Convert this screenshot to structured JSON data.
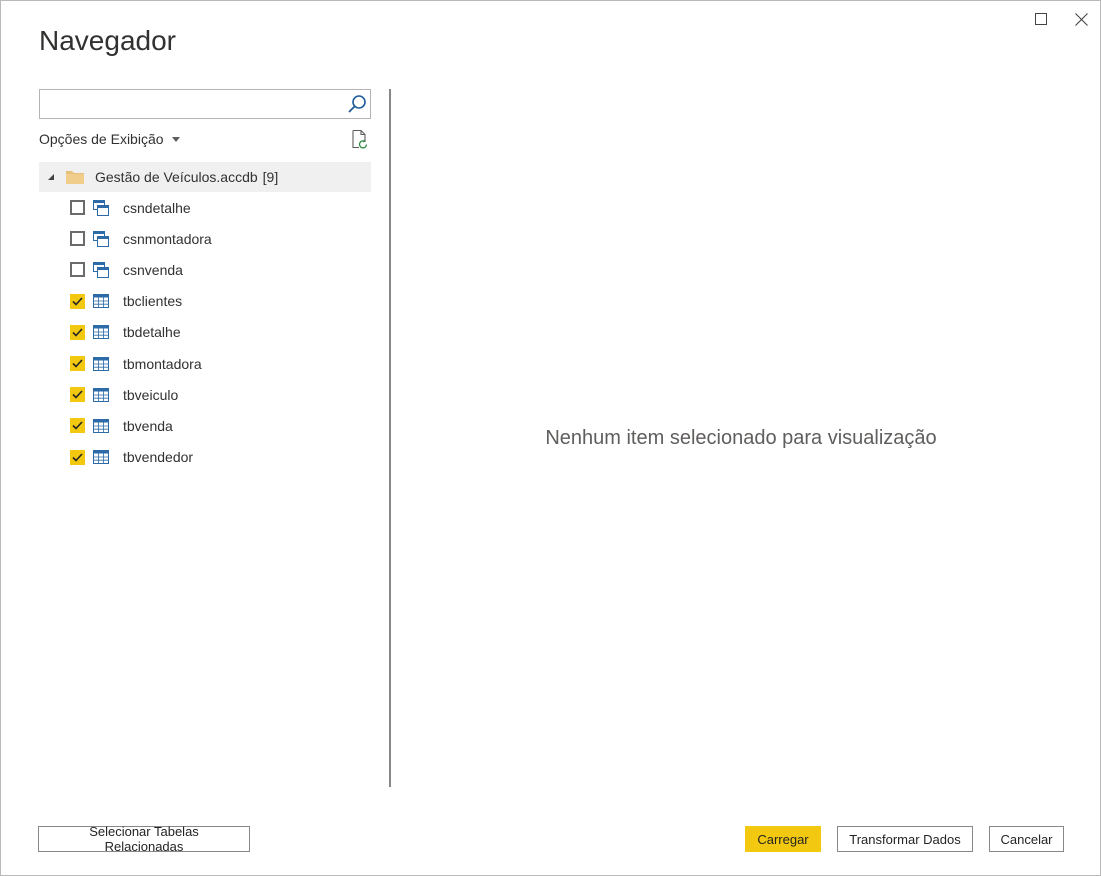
{
  "window": {
    "title": "Navegador",
    "maximize_icon": "maximize-icon",
    "close_icon": "close-icon"
  },
  "search": {
    "value": "",
    "placeholder": "",
    "icon": "search-icon"
  },
  "view_options": {
    "label": "Opções de Exibição",
    "icon": "caret-down-icon"
  },
  "refresh": {
    "icon": "refresh-document-icon"
  },
  "tree": {
    "root": {
      "label": "Gestão de Veículos.accdb",
      "count": "[9]",
      "icon": "folder-icon",
      "expanded": true
    },
    "items": [
      {
        "label": "csndetalhe",
        "type": "view",
        "checked": false
      },
      {
        "label": "csnmontadora",
        "type": "view",
        "checked": false
      },
      {
        "label": "csnvenda",
        "type": "view",
        "checked": false
      },
      {
        "label": "tbclientes",
        "type": "table",
        "checked": true
      },
      {
        "label": "tbdetalhe",
        "type": "table",
        "checked": true
      },
      {
        "label": "tbmontadora",
        "type": "table",
        "checked": true
      },
      {
        "label": "tbveiculo",
        "type": "table",
        "checked": true
      },
      {
        "label": "tbvenda",
        "type": "table",
        "checked": true
      },
      {
        "label": "tbvendedor",
        "type": "table",
        "checked": true
      }
    ]
  },
  "preview": {
    "message": "Nenhum item selecionado para visualização"
  },
  "footer": {
    "select_related": "Selecionar Tabelas Relacionadas",
    "load": "Carregar",
    "transform": "Transformar Dados",
    "cancel": "Cancelar"
  },
  "colors": {
    "accent": "#f2c811",
    "checkbox_off_border": "#6b6b6b",
    "tree_selected_bg": "#f0f0f0"
  }
}
